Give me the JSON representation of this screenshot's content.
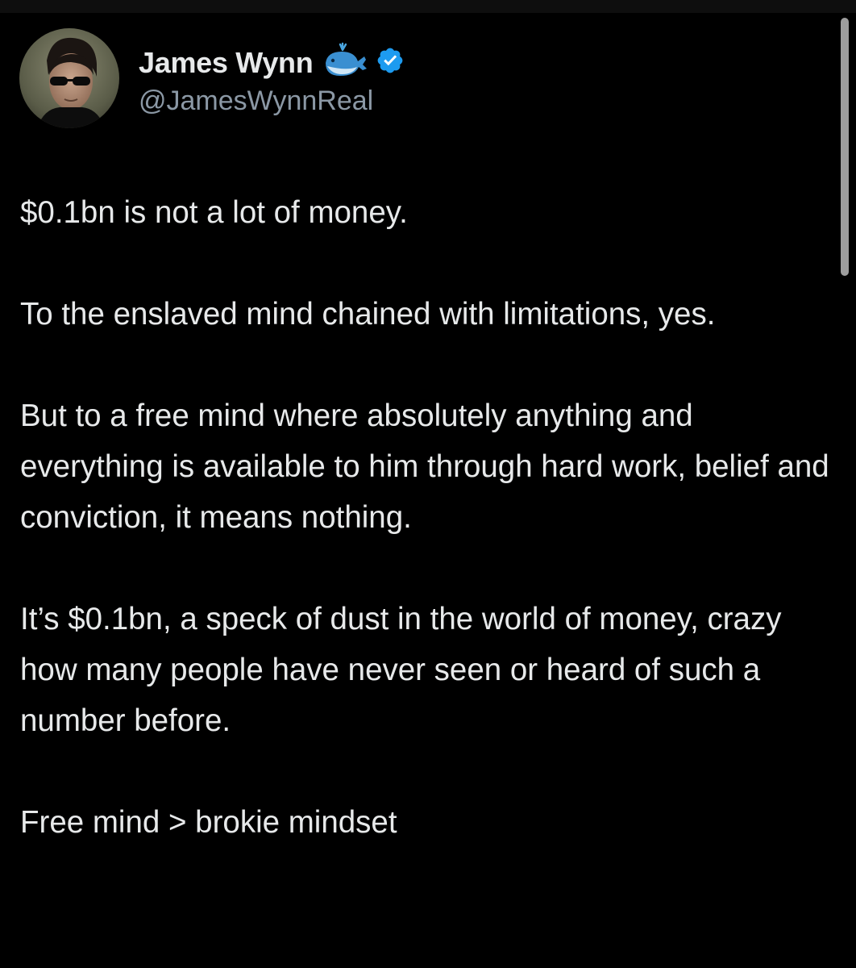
{
  "theme": {
    "background": "#000000",
    "text_color": "#e7e9ea",
    "secondary_text": "#8b98a5",
    "verified_color": "#1d9bf0"
  },
  "author": {
    "display_name": "James Wynn",
    "handle": "@JamesWynnReal",
    "emoji_icon": "whale-emoji",
    "verified_icon": "verified-badge"
  },
  "tweet": {
    "paragraphs": [
      "$0.1bn is not a lot of money.",
      "To the enslaved mind chained with limitations, yes.",
      "But to a free mind where absolutely anything and everything is available to him through hard work, belief and conviction, it means nothing.",
      "It’s $0.1bn, a speck of dust in the world of money, crazy how many people have never seen or heard of such a number before.",
      "Free mind > brokie mindset"
    ]
  }
}
